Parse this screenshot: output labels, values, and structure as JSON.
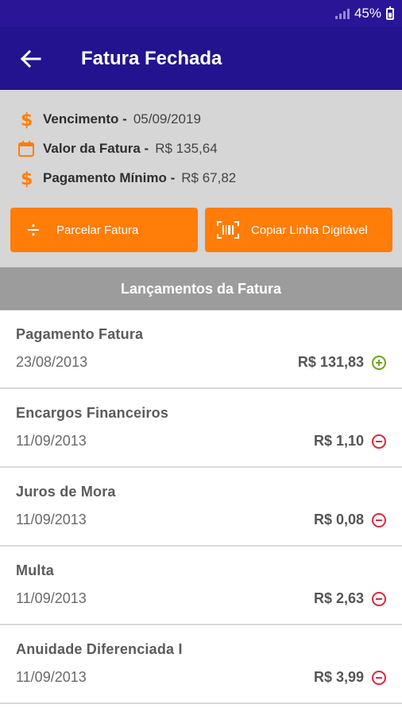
{
  "status_bar": {
    "battery_text": "45%"
  },
  "app_bar": {
    "title": "Fatura Fechada",
    "back_icon": "arrow-left-icon"
  },
  "summary": {
    "rows": [
      {
        "icon": "dollar-icon",
        "label": "Vencimento -",
        "value": "05/09/2019"
      },
      {
        "icon": "calendar-icon",
        "label": "Valor da Fatura -",
        "value": "R$ 135,64"
      },
      {
        "icon": "dollar-icon",
        "label": "Pagamento Mínimo -",
        "value": "R$ 67,82"
      }
    ],
    "buttons": {
      "parcelar": {
        "label": "Parcelar Fatura",
        "icon": "divide-icon"
      },
      "copiar": {
        "label": "Copiar Linha Digitável",
        "icon": "barcode-icon"
      }
    },
    "accent_color": "#ff7d08"
  },
  "section": {
    "title": "Lançamentos da Fatura"
  },
  "transactions": [
    {
      "title": "Pagamento Fatura",
      "date": "23/08/2013",
      "amount": "R$ 131,83",
      "type": "credit"
    },
    {
      "title": "Encargos Financeiros",
      "date": "11/09/2013",
      "amount": "R$ 1,10",
      "type": "debit"
    },
    {
      "title": "Juros de Mora",
      "date": "11/09/2013",
      "amount": "R$ 0,08",
      "type": "debit"
    },
    {
      "title": "Multa",
      "date": "11/09/2013",
      "amount": "R$ 2,63",
      "type": "debit"
    },
    {
      "title": "Anuidade Diferenciada I",
      "date": "11/09/2013",
      "amount": "R$ 3,99",
      "type": "debit"
    }
  ],
  "colors": {
    "header": "#23138e",
    "credit": "#6aa41e",
    "debit": "#e0263b"
  }
}
